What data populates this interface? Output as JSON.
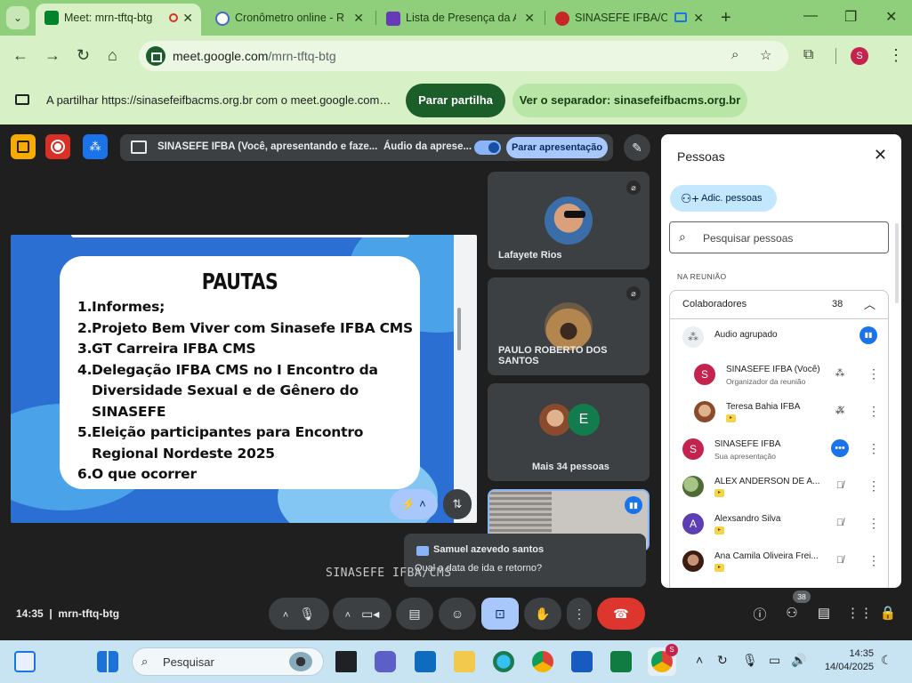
{
  "browser": {
    "tabs": [
      {
        "title": "Meet: mrn-tftq-btg",
        "active": true,
        "recording_icon": "record-icon"
      },
      {
        "title": "Cronômetro online - R",
        "active": false
      },
      {
        "title": "Lista de Presença da A",
        "active": false
      },
      {
        "title": "SINASEFE IFBA/CM",
        "active": false
      }
    ],
    "url_host": "meet.google.com",
    "url_path": "/mrn-tftq-btg",
    "profile_initial": "S"
  },
  "sharebar": {
    "message": "A partilhar https://sinasefeifbacms.org.br com o meet.google.com…",
    "stop_label": "Parar partilha",
    "view_label": "Ver o separador: sinasefeifbacms.org.br"
  },
  "meet": {
    "presenting_text": "SINASEFE IFBA (Você, apresentando e faze...",
    "audio_text": "Áudio da aprese...",
    "stop_presenting_label": "Parar apresentação",
    "slide": {
      "title": "PAUTAS",
      "items": [
        {
          "n": "1.",
          "text": "Informes;"
        },
        {
          "n": "2.",
          "text": "Projeto Bem Viver com Sinasefe IFBA CMS"
        },
        {
          "n": "3.",
          "text": "GT Carreira IFBA CMS"
        },
        {
          "n": "4.",
          "text": "Delegação IFBA CMS no I Encontro da Diversidade Sexual e de Gênero do SINASEFE"
        },
        {
          "n": "5.",
          "text": "Eleição participantes para Encontro Regional Nordeste 2025"
        },
        {
          "n": "6.",
          "text": "O que ocorrer"
        }
      ]
    },
    "tiles": [
      {
        "name": "Lafayete Rios"
      },
      {
        "name": "PAULO ROBERTO DOS SANTOS"
      },
      {
        "name": "Mais 34 pessoas",
        "extra_initial": "E"
      }
    ],
    "chat_popup": {
      "sender": "Samuel azevedo santos",
      "message": "Qual a data de ida e retorno?"
    },
    "watermark": "SINASEFE IFBA/CMS",
    "meeting_time": "14:35",
    "meeting_code": "mrn-tftq-btg",
    "participants_badge": "38"
  },
  "people": {
    "title": "Pessoas",
    "add_label": "Adic. pessoas",
    "search_placeholder": "Pesquisar pessoas",
    "section_label": "NA REUNIÃO",
    "group_label": "Colaboradores",
    "group_count": "38",
    "grouped_audio": "Áudio agrupado",
    "rows": [
      {
        "name": "SINASEFE IFBA (Você)",
        "sub": "Organizador da reunião",
        "initial": "S",
        "color": "#c5224d"
      },
      {
        "name": "Teresa Bahia IFBA",
        "sub": "",
        "initial": "",
        "color": "#c98f6a"
      },
      {
        "name": "SINASEFE IFBA",
        "sub": "Sua apresentação",
        "initial": "S",
        "color": "#c5224d"
      },
      {
        "name": "ALEX ANDERSON DE A...",
        "sub": "",
        "initial": "",
        "color": "#6b8f4e"
      },
      {
        "name": "Alexsandro Silva",
        "sub": "",
        "initial": "A",
        "color": "#5b3fb3"
      },
      {
        "name": "Ana Camila Oliveira Frei...",
        "sub": "",
        "initial": "",
        "color": "#7a3b22"
      }
    ]
  },
  "taskbar": {
    "search_label": "Pesquisar",
    "time": "14:35",
    "date": "14/04/2025"
  },
  "colors": {
    "chrome_green": "#8fce7a",
    "chrome_light": "#d7f0c5",
    "meet_bg": "#1f1f1f",
    "accent_blue": "#a8c7fa",
    "end_call_red": "#dc362e"
  }
}
